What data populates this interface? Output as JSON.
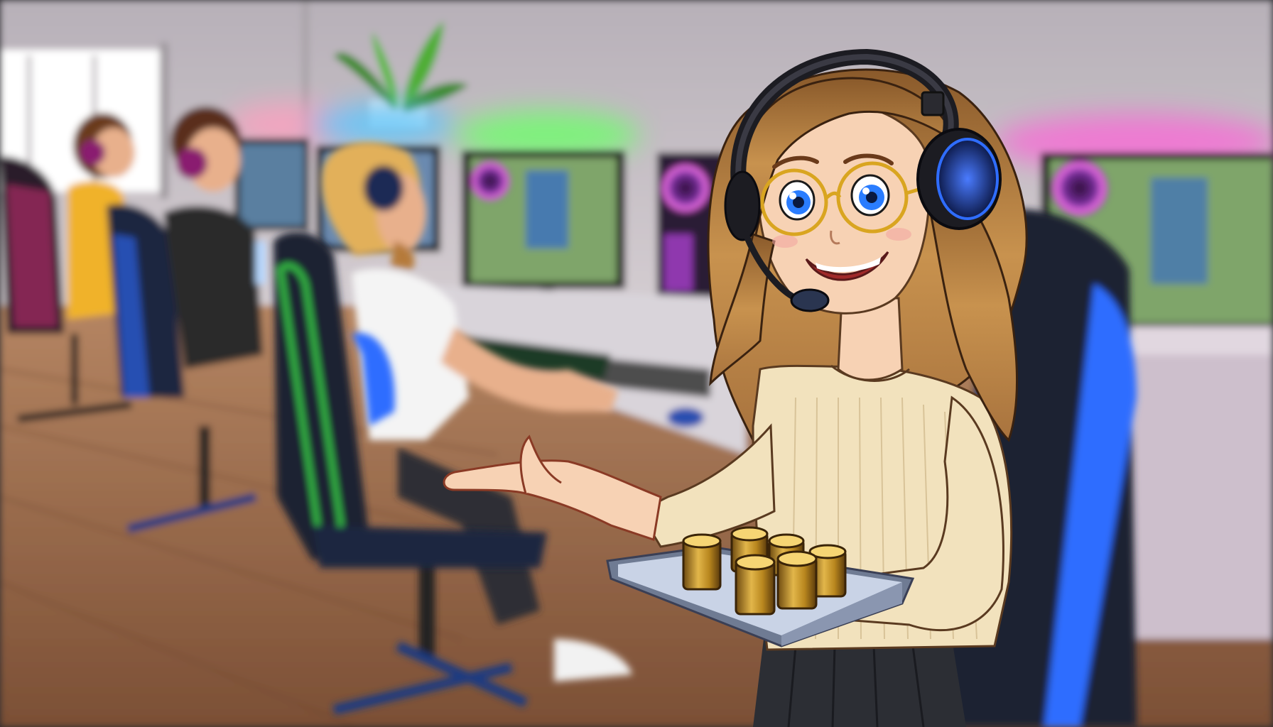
{
  "scene": {
    "title": "",
    "palette": {
      "wall": "#c9c2c7",
      "floor": "#9a6a48",
      "neon_green": "#6dff6a",
      "neon_blue": "#5ac8ff",
      "neon_pink": "#ff5fd8",
      "hair": "#b9844a",
      "sweater": "#f2e2bd",
      "tray": "#c9d3e6",
      "cups": "#b8861e",
      "headset_accent": "#2f6dff"
    },
    "subjects": [
      {
        "name": "girl-with-headset",
        "role": "foreground"
      },
      {
        "name": "gamer-white-shirt",
        "role": "background"
      },
      {
        "name": "gamer-black-shirt",
        "role": "background"
      },
      {
        "name": "gamer-yellow-shirt",
        "role": "background"
      }
    ],
    "tray_cup_count": 6
  }
}
